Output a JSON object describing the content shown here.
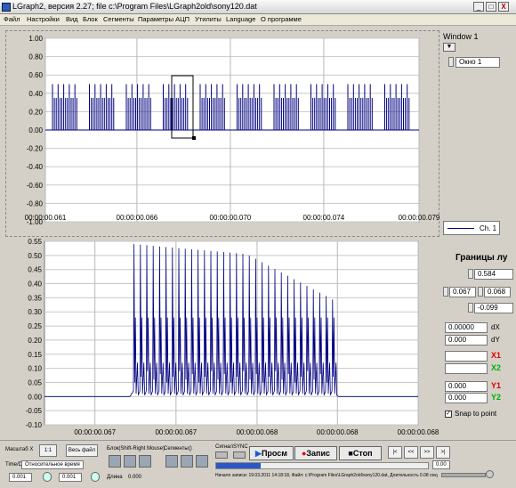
{
  "window": {
    "title": "LGraph2, версия 2.27; file c:\\Program Files\\LGraph2old\\sony120.dat",
    "min": "_",
    "max": "□",
    "close": "X"
  },
  "menu": [
    "Файл",
    "Настройки",
    "Вид",
    "Блок",
    "Сегменты",
    "Параметры АЦП",
    "Утилиты",
    "Language",
    "О программе"
  ],
  "top_chart": {
    "yticks": [
      "1.00",
      "0.80",
      "0.60",
      "0.40",
      "0.20",
      "0.00",
      "-0.20",
      "-0.40",
      "-0.60",
      "-0.80",
      "-1.00"
    ],
    "xticks": [
      "00:00:00.061",
      "00:00:00.066",
      "00:00:00.070",
      "00:00:00.074",
      "00:00:00.079"
    ]
  },
  "bottom_chart": {
    "yticks": [
      "0.55",
      "0.50",
      "0.45",
      "0.40",
      "0.35",
      "0.30",
      "0.25",
      "0.20",
      "0.15",
      "0.10",
      "0.05",
      "0.00",
      "-0.05",
      "-0.10"
    ],
    "xticks": [
      "00:00:00.067",
      "00:00:00.067",
      "00:00:00.068",
      "00:00:00.068",
      "00:00:00.068"
    ]
  },
  "right_panel": {
    "window_label": "Window 1",
    "window_select": "Окно 1",
    "channel": "Ch. 1",
    "bounds_label": "Границы лу",
    "y_top": "0.584",
    "x_left": "0.067",
    "x_right": "0.068",
    "y_bottom": "-0.099",
    "dx_value": "0.00000",
    "dx_label": "dX",
    "dy_value": "0.000",
    "dy_label": "dY",
    "x1_label": "X1",
    "x2_label": "X2",
    "y1_value": "0.000",
    "y1_label": "Y1",
    "y2_value": "0.000",
    "y2_label": "Y2",
    "snap_label": "Snap to point"
  },
  "bottom_bar": {
    "masshtab_label": "Масштаб X",
    "btn_11": "1:1",
    "btn_all": "Весь файл",
    "time_label": "Time/Div",
    "time_mode": "Относительное время",
    "time_val1": "0.001",
    "time_val2": "0.001",
    "block_label": "Блок(Shift-Right Mouse)",
    "length_label": "Длина",
    "length_val": "0.000",
    "segments_label": "Сегменты()",
    "signal_label": "Сигнал",
    "sync_label": "SYNC",
    "btn_play": "Просм",
    "btn_rec": "Запис",
    "btn_stop": "Стоп",
    "nav_first": "|<",
    "nav_prev": "<<",
    "nav_next": ">>",
    "nav_last": ">|",
    "status": "Начало записи: 19.03.2011 14:18:18, Файл: c:\\Program Files\\LGraph2old\\sony120.dat, Длительность 0.08 секунды",
    "counter": "0.00"
  },
  "chart_data": [
    {
      "type": "line",
      "title": "",
      "xlabel": "",
      "ylabel": "",
      "xlim": [
        "00:00:00.061",
        "00:00:00.079"
      ],
      "ylim": [
        -1.0,
        1.0
      ],
      "yticks": [
        1.0,
        0.8,
        0.6,
        0.4,
        0.2,
        0.0,
        -0.2,
        -0.4,
        -0.6,
        -0.8,
        -1.0
      ],
      "series": [
        {
          "name": "Ch. 1",
          "color": "#000080",
          "description_values": {
            "burst_high": 0.5,
            "baseline": 0.0,
            "burst_count": 10
          }
        }
      ],
      "grid": true
    },
    {
      "type": "line",
      "title": "",
      "xlabel": "",
      "ylabel": "",
      "xlim": [
        "00:00:00.067",
        "00:00:00.068"
      ],
      "ylim": [
        -0.1,
        0.55
      ],
      "yticks": [
        0.55,
        0.5,
        0.45,
        0.4,
        0.35,
        0.3,
        0.25,
        0.2,
        0.15,
        0.1,
        0.05,
        0.0,
        -0.05,
        -0.1
      ],
      "series": [
        {
          "name": "Ch. 1",
          "color": "#000080",
          "peak": 0.54,
          "baseline": 0.0,
          "pulses": 32
        }
      ],
      "grid": true
    }
  ]
}
